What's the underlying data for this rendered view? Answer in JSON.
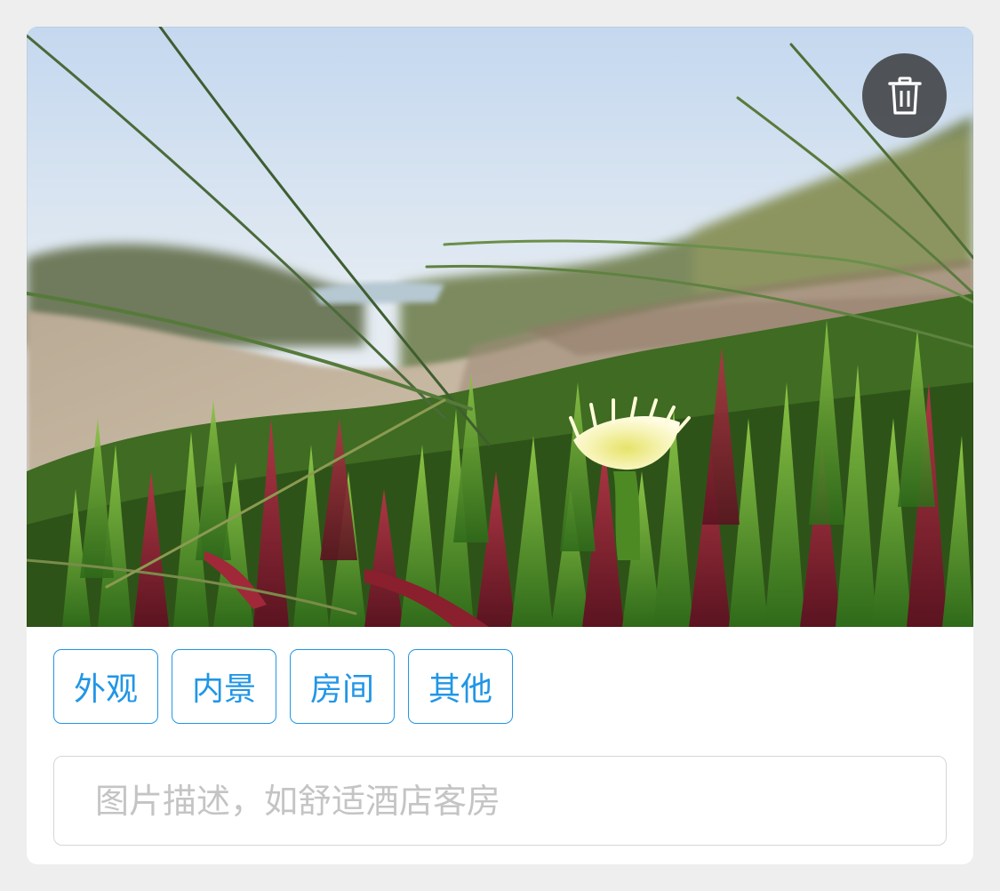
{
  "photo": {
    "alt_description_icon": "uploaded-photo",
    "colors": {
      "sky_top": "#c6daf0",
      "sky_bottom": "#eef2f6",
      "sand": "#c9b8a0",
      "leaf_green": "#5a9a2a",
      "leaf_red": "#8a2030",
      "flower": "#f3f1a8"
    }
  },
  "delete_button": {
    "icon": "trash-icon",
    "background": "#2d2d2d"
  },
  "tags": [
    {
      "label": "外观"
    },
    {
      "label": "内景"
    },
    {
      "label": "房间"
    },
    {
      "label": "其他"
    }
  ],
  "tag_color": "#2196e6",
  "description": {
    "value": "",
    "placeholder": "图片描述，如舒适酒店客房"
  }
}
